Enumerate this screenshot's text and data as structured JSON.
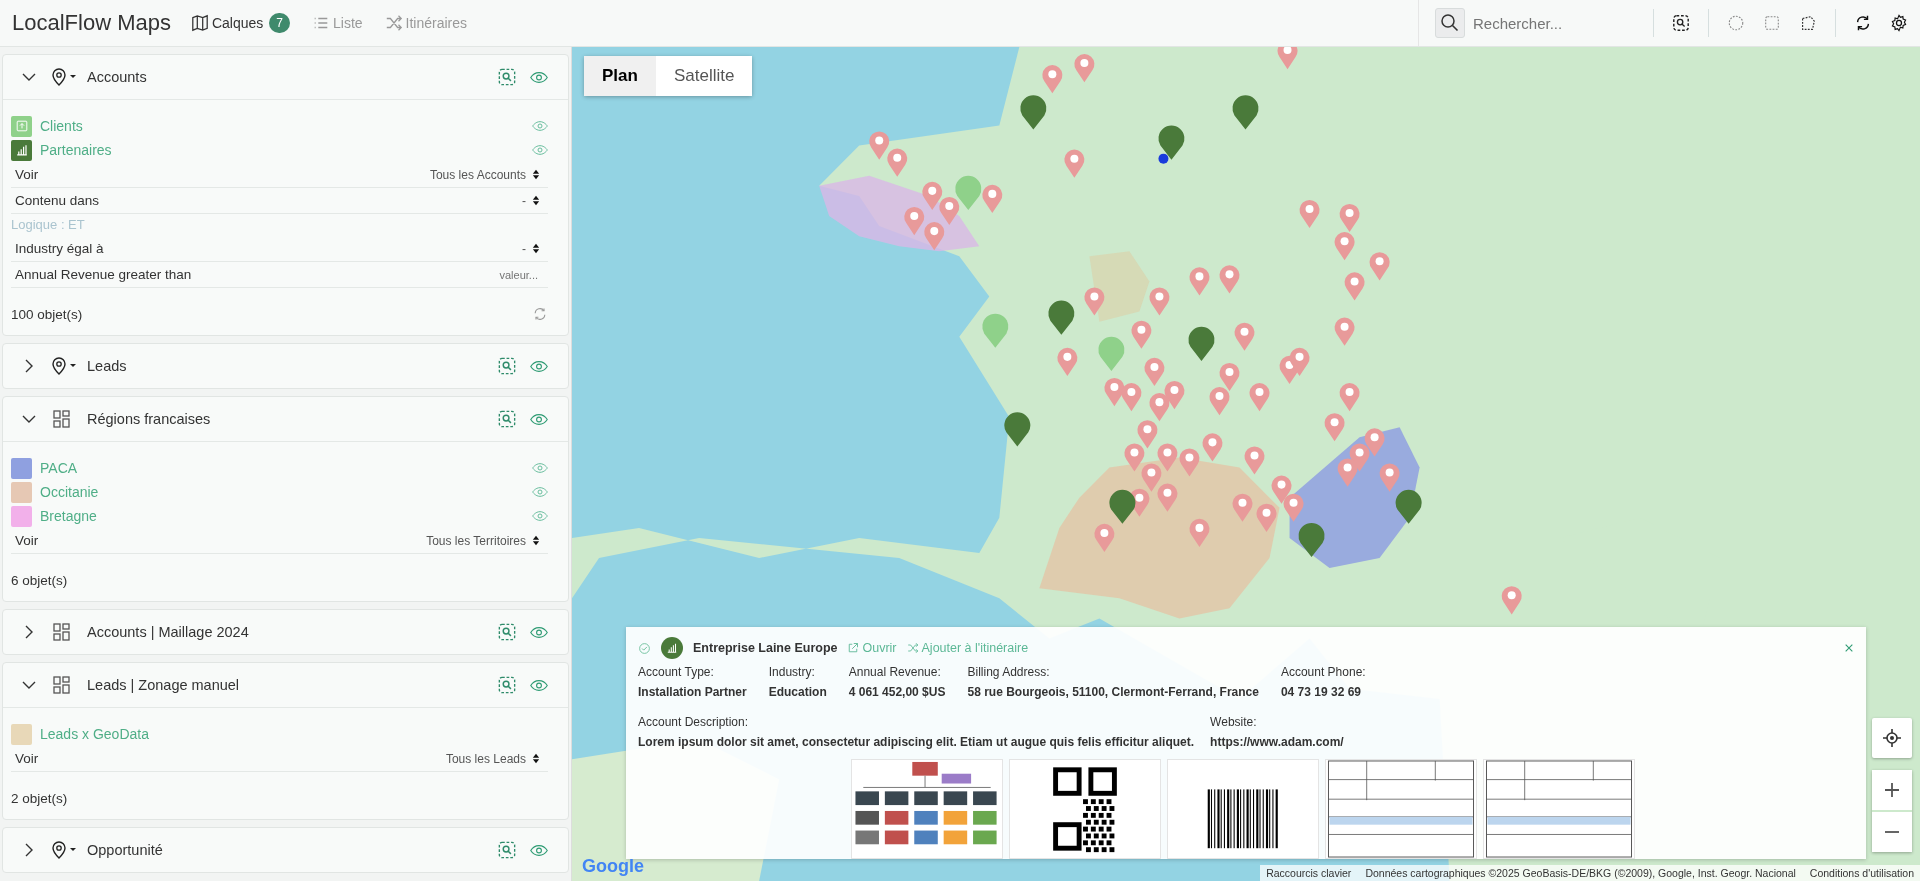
{
  "app": {
    "title": "LocalFlow Maps"
  },
  "nav_tabs": [
    {
      "label": "Calques",
      "badge": "7",
      "selected": true,
      "kind": "layers"
    },
    {
      "label": "Liste",
      "selected": false,
      "kind": "list"
    },
    {
      "label": "Itinéraires",
      "selected": false,
      "kind": "route"
    }
  ],
  "search": {
    "placeholder": "Rechercher..."
  },
  "layers": [
    {
      "kind": "pin",
      "title": "Accounts",
      "expanded": true,
      "items": [
        {
          "label": "Clients",
          "color": "#8fd18a",
          "kind": "upload",
          "visible": true
        },
        {
          "label": "Partenaires",
          "color": "#4a7a3a",
          "kind": "chart",
          "visible": true
        }
      ],
      "filters": [
        {
          "kind": "select",
          "label": "Voir",
          "value": "Tous les Accounts"
        },
        {
          "kind": "select",
          "label": "Contenu dans",
          "value": "-"
        },
        {
          "kind": "logic",
          "label": "Logique : ET"
        },
        {
          "kind": "select",
          "label": "Industry égal à",
          "value": "-"
        },
        {
          "kind": "input",
          "label": "Annual Revenue greater than",
          "placeholder": "valeur..."
        }
      ],
      "count": "100 objet(s)",
      "refresh": true
    },
    {
      "kind": "pin",
      "title": "Leads",
      "expanded": false
    },
    {
      "kind": "territory",
      "title": "Régions francaises",
      "expanded": true,
      "items": [
        {
          "label": "PACA",
          "color": "#8fa0e0",
          "kind": "swatch",
          "visible": true
        },
        {
          "label": "Occitanie",
          "color": "#e6c8b4",
          "kind": "swatch",
          "visible": true
        },
        {
          "label": "Bretagne",
          "color": "#f2b0ea",
          "kind": "swatch",
          "visible": true
        }
      ],
      "filters": [
        {
          "kind": "select",
          "label": "Voir",
          "value": "Tous les Territoires"
        }
      ],
      "count": "6 objet(s)",
      "refresh": false
    },
    {
      "kind": "territory",
      "title": "Accounts | Maillage 2024",
      "expanded": false
    },
    {
      "kind": "territory",
      "title": "Leads | Zonage manuel",
      "expanded": true,
      "items": [
        {
          "label": "Leads x GeoData",
          "color": "#e8d8b8",
          "kind": "swatch",
          "visible": false
        }
      ],
      "filters": [
        {
          "kind": "select",
          "label": "Voir",
          "value": "Tous les Leads"
        }
      ],
      "count": "2 objet(s)",
      "refresh": false
    },
    {
      "kind": "pin",
      "title": "Opportunité",
      "expanded": false
    }
  ],
  "map": {
    "modes": [
      {
        "label": "Plan",
        "selected": true
      },
      {
        "label": "Satellite",
        "selected": false
      }
    ],
    "logo": "Google",
    "attribution": [
      "Raccourcis clavier",
      "Données cartographiques ©2025 GeoBasis-DE/BKG (©2009), Google, Inst. Geogr. Nacional",
      "Conditions d'utilisation"
    ]
  },
  "popup": {
    "title": "Entreprise Laine Europe",
    "actions": [
      {
        "label": "Ouvrir",
        "kind": "open"
      },
      {
        "label": "Ajouter à l'itinéraire",
        "kind": "route"
      }
    ],
    "fields": [
      {
        "label": "Account Type:",
        "value": "Installation Partner"
      },
      {
        "label": "Industry:",
        "value": "Education"
      },
      {
        "label": "Annual Revenue:",
        "value": "4 061 452,00 $US"
      },
      {
        "label": "Billing Address:",
        "value": "58 rue Bourgeois, 51100, Clermont-Ferrand, France"
      },
      {
        "label": "Account Phone:",
        "value": "04 73 19 32 69"
      }
    ],
    "details": [
      {
        "label": "Account Description:",
        "value": "Lorem ipsum dolor sit amet, consectetur adipiscing elit. Etiam ut augue quis felis efficitur aliquet."
      },
      {
        "label": "Website:",
        "value": "https://www.adam.com/"
      }
    ],
    "attachments": [
      {
        "kind": "org-chart"
      },
      {
        "kind": "qr-code"
      },
      {
        "kind": "barcode"
      },
      {
        "kind": "document"
      },
      {
        "kind": "document"
      }
    ]
  }
}
